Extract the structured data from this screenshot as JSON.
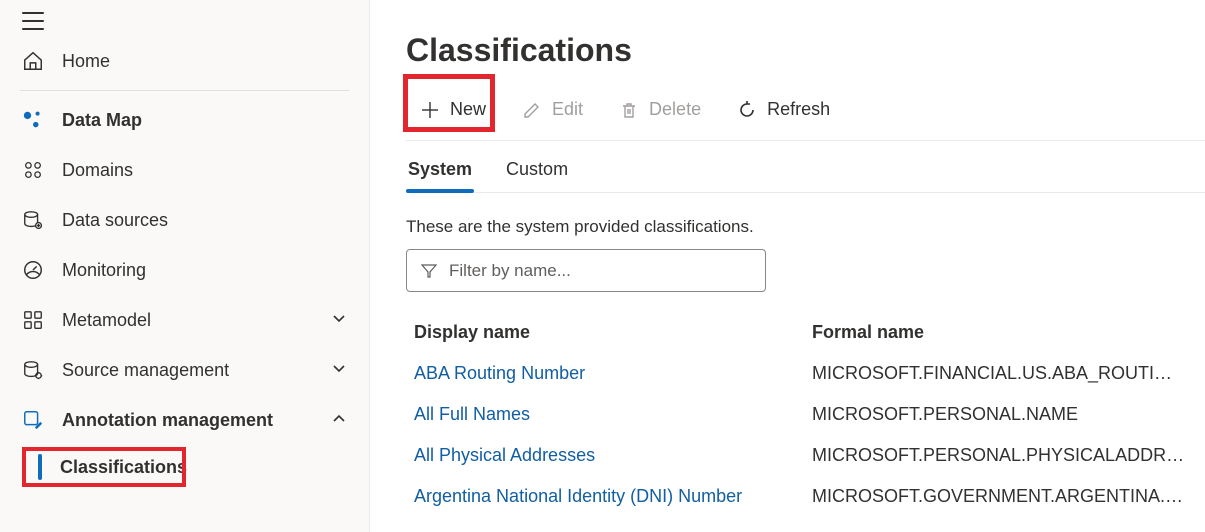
{
  "sidebar": {
    "home": "Home",
    "section": "Data Map",
    "items": [
      {
        "label": "Domains"
      },
      {
        "label": "Data sources"
      },
      {
        "label": "Monitoring"
      },
      {
        "label": "Metamodel"
      },
      {
        "label": "Source management"
      },
      {
        "label": "Annotation management"
      }
    ],
    "subitem": "Classifications"
  },
  "page": {
    "title": "Classifications"
  },
  "toolbar": {
    "new": "New",
    "edit": "Edit",
    "delete": "Delete",
    "refresh": "Refresh"
  },
  "tabs": {
    "system": "System",
    "custom": "Custom"
  },
  "hint": "These are the system provided classifications.",
  "filter": {
    "placeholder": "Filter by name..."
  },
  "table": {
    "headers": {
      "display": "Display name",
      "formal": "Formal name"
    },
    "rows": [
      {
        "display": "ABA Routing Number",
        "formal": "MICROSOFT.FINANCIAL.US.ABA_ROUTING_NU…"
      },
      {
        "display": "All Full Names",
        "formal": "MICROSOFT.PERSONAL.NAME"
      },
      {
        "display": "All Physical Addresses",
        "formal": "MICROSOFT.PERSONAL.PHYSICALADDRESS"
      },
      {
        "display": "Argentina National Identity (DNI) Number",
        "formal": "MICROSOFT.GOVERNMENT.ARGENTINA.DNI_…"
      }
    ]
  }
}
